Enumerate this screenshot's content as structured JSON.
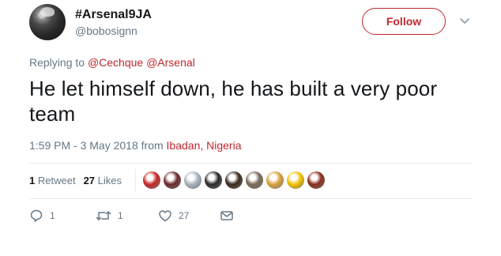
{
  "author": {
    "display_name": "#Arsenal9JA",
    "handle": "@bobosignn"
  },
  "follow_label": "Follow",
  "replying": {
    "prefix": "Replying to",
    "mentions": [
      "@Cechque",
      "@Arsenal"
    ]
  },
  "tweet_text": "He let himself down, he has built a very poor team",
  "meta": {
    "timestamp": "1:59 PM - 3 May 2018",
    "from_label": "from",
    "location": "Ibadan, Nigeria"
  },
  "stats": {
    "retweets_count": "1",
    "retweets_label": "Retweet",
    "likes_count": "27",
    "likes_label": "Likes"
  },
  "liker_avatars": [
    {
      "name": "liker-1",
      "color": "#c62828"
    },
    {
      "name": "liker-2",
      "color": "#6d2b2b"
    },
    {
      "name": "liker-3",
      "color": "#a9b4bd"
    },
    {
      "name": "liker-4",
      "color": "#2b2b2b"
    },
    {
      "name": "liker-5",
      "color": "#3a2a1a"
    },
    {
      "name": "liker-6",
      "color": "#7a6a58"
    },
    {
      "name": "liker-7",
      "color": "#d9a23b"
    },
    {
      "name": "liker-8",
      "color": "#f2c200"
    },
    {
      "name": "liker-9",
      "color": "#8a2e1a"
    }
  ],
  "actions": {
    "reply_count": "1",
    "retweet_count": "1",
    "like_count": "27"
  },
  "colors": {
    "accent": "#c0272d",
    "secondary_text": "#657786",
    "primary_text": "#14171a"
  }
}
